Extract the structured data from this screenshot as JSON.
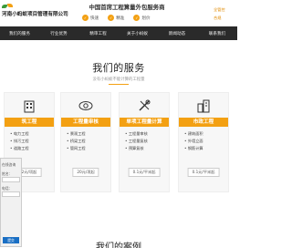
{
  "header": {
    "company_name": "河南小蚂蚁项目管理有限公司",
    "center_title": "中国首席工程算量外包服务商",
    "features": [
      {
        "icon": "fast-icon",
        "label": "快速"
      },
      {
        "icon": "precise-icon",
        "label": "精准"
      },
      {
        "icon": "good-price-icon",
        "label": "划价"
      }
    ],
    "right_links": [
      "全管控",
      "合规"
    ]
  },
  "nav": {
    "items": [
      "我们的服务",
      "行业优势",
      "精审工程",
      "关于小蚂蚁",
      "新闻动态",
      "联系我们"
    ]
  },
  "services": {
    "title": "我们的服务",
    "subtitle": "没有小蚂蚁不能计算的工程量",
    "cards": [
      {
        "icon": "building-icon",
        "title": "筑工程",
        "items": [
          "电力工程",
          "排污工程",
          "道路工程"
        ],
        "price": "2元/项起"
      },
      {
        "icon": "eye-icon",
        "title": "工程量审核",
        "items": [
          "景观工程",
          "桥梁工程",
          "管网工程"
        ],
        "price": "20元/项起"
      },
      {
        "icon": "tools-icon",
        "title": "单项工程量计算",
        "items": [
          "工程量审核",
          "工程量复核",
          "预算复核"
        ],
        "price": "0.1元/平米起"
      },
      {
        "icon": "city-icon",
        "title": "市政工程",
        "items": [
          "建筑面积",
          "外墙立面",
          "钢筋计算"
        ],
        "price": "0.1元/平米起"
      }
    ]
  },
  "consult_panel": {
    "labels": [
      "在线咨询",
      "姓名：",
      "电话："
    ],
    "submit_label": "提交"
  },
  "cases": {
    "title": "我们的案例"
  }
}
